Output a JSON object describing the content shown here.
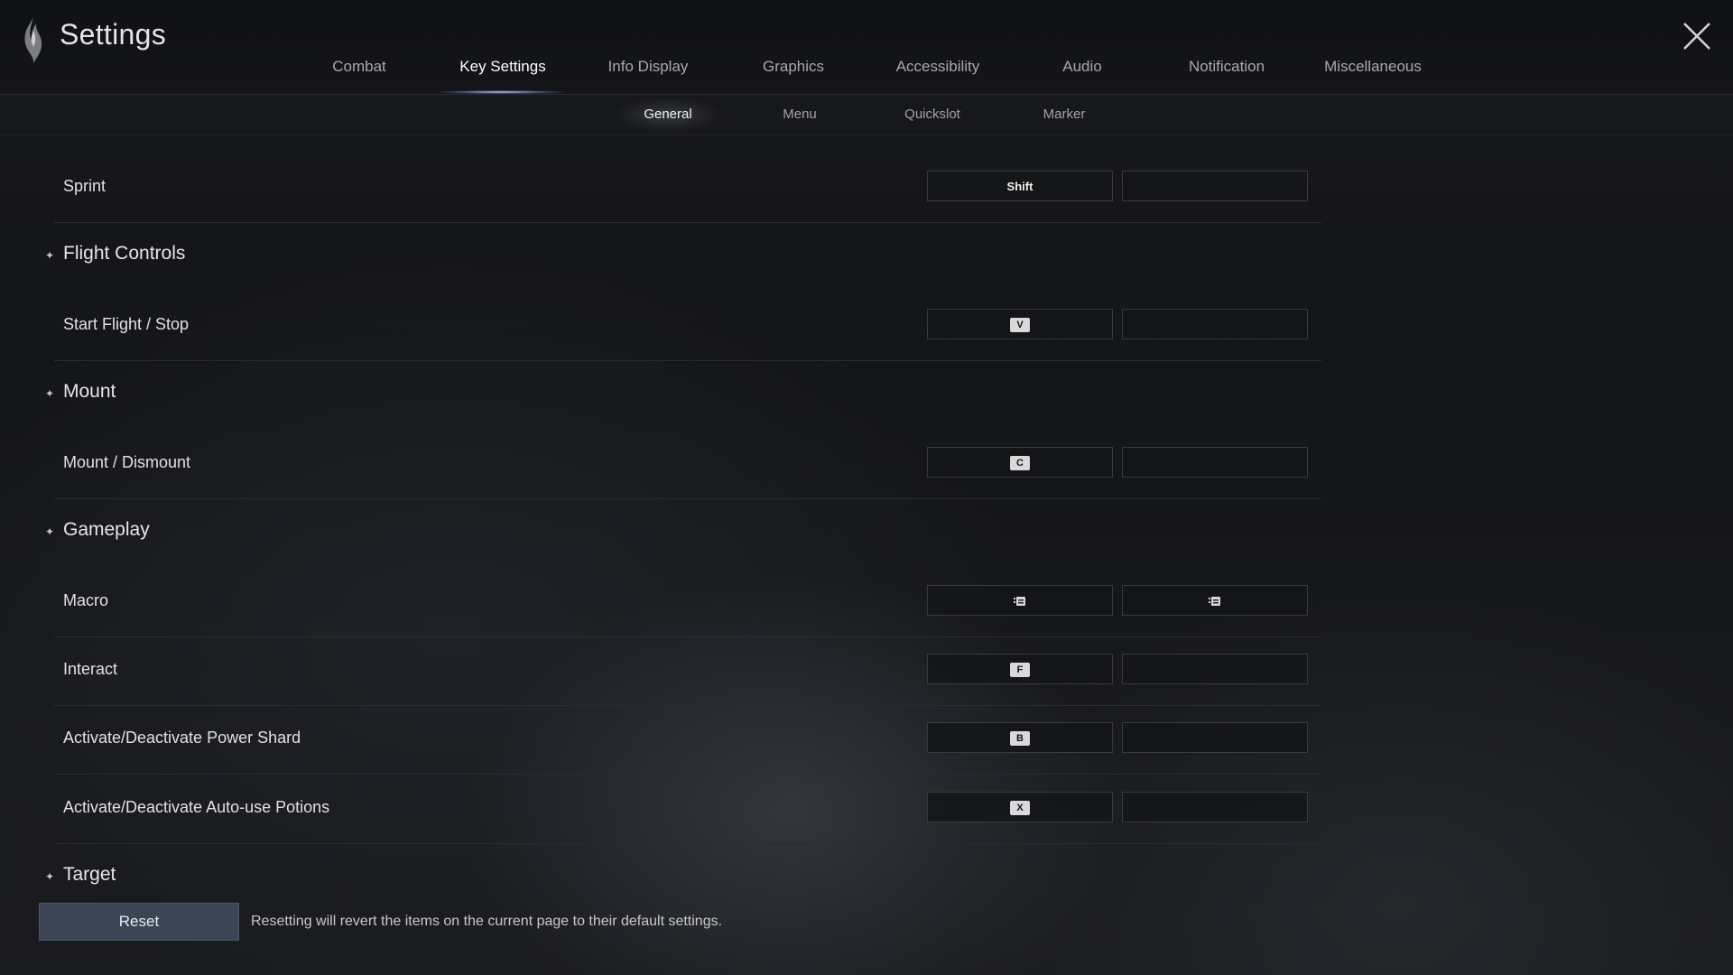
{
  "header": {
    "title": "Settings",
    "logo_icon": "flame-crest-icon",
    "close_icon": "close-icon"
  },
  "tabs": [
    {
      "label": "Combat",
      "active": false
    },
    {
      "label": "Key Settings",
      "active": true
    },
    {
      "label": "Info Display",
      "active": false
    },
    {
      "label": "Graphics",
      "active": false
    },
    {
      "label": "Accessibility",
      "active": false
    },
    {
      "label": "Audio",
      "active": false
    },
    {
      "label": "Notification",
      "active": false
    },
    {
      "label": "Miscellaneous",
      "active": false
    }
  ],
  "subtabs": [
    {
      "label": "General",
      "active": true
    },
    {
      "label": "Menu",
      "active": false
    },
    {
      "label": "Quickslot",
      "active": false
    },
    {
      "label": "Marker",
      "active": false
    }
  ],
  "bindings": {
    "sprint": {
      "label": "Sprint",
      "primary": "Shift",
      "secondary": ""
    },
    "flight_section": "Flight Controls",
    "start_flight": {
      "label": "Start Flight / Stop",
      "primary": "V",
      "secondary": ""
    },
    "mount_section": "Mount",
    "mount_dismount": {
      "label": "Mount / Dismount",
      "primary": "C",
      "secondary": ""
    },
    "gameplay_section": "Gameplay",
    "macro": {
      "label": "Macro",
      "primary_icon": "macro-keycap-icon",
      "secondary_icon": "macro-keycap-icon"
    },
    "interact": {
      "label": "Interact",
      "primary": "F",
      "secondary": ""
    },
    "power_shard": {
      "label": "Activate/Deactivate Power Shard",
      "primary": "B",
      "secondary": ""
    },
    "auto_potions": {
      "label": "Activate/Deactivate Auto-use Potions",
      "primary": "X",
      "secondary": ""
    },
    "target_section": "Target"
  },
  "footer": {
    "reset_label": "Reset",
    "reset_note": "Resetting will revert the items on the current page to their default settings."
  },
  "colors": {
    "background": "#141518",
    "accent_underline": "#b4c8ff",
    "reset_button": "#3b4556"
  }
}
